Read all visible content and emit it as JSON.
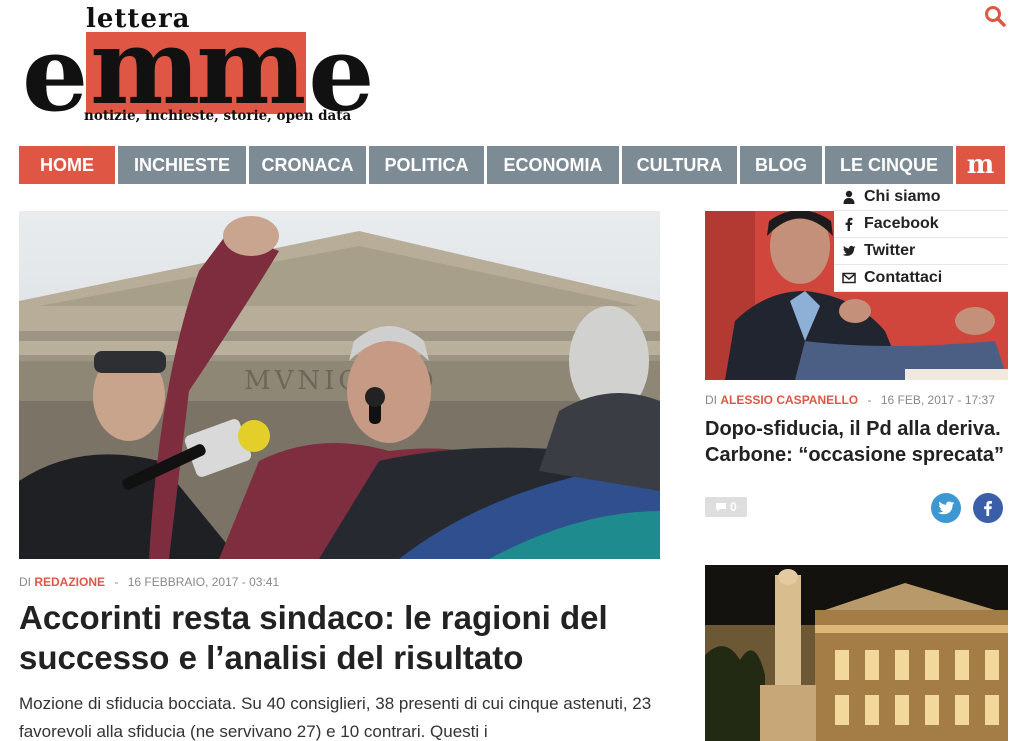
{
  "logo": {
    "top_word": "lettera",
    "main_left": "e",
    "main_mid": "mm",
    "main_right": "e",
    "tagline": "notizie, inchieste, storie, open data"
  },
  "icons": {
    "search": "search-icon",
    "menu_logo": "m-logo-icon"
  },
  "nav": {
    "items": [
      {
        "label": "HOME",
        "active": true
      },
      {
        "label": "INCHIESTE"
      },
      {
        "label": "CRONACA"
      },
      {
        "label": "POLITICA"
      },
      {
        "label": "ECONOMIA"
      },
      {
        "label": "CULTURA"
      },
      {
        "label": "BLOG"
      },
      {
        "label": "LE CINQUE"
      }
    ],
    "m_label": "m"
  },
  "dropdown": {
    "items": [
      {
        "label": "Chi siamo",
        "icon": "user-icon"
      },
      {
        "label": "Facebook",
        "icon": "facebook-icon"
      },
      {
        "label": "Twitter",
        "icon": "twitter-icon"
      },
      {
        "label": "Contattaci",
        "icon": "envelope-icon"
      }
    ]
  },
  "main_article": {
    "by": "DI",
    "author": "REDAZIONE",
    "date": "16 FEBBRAIO, 2017 - 03:41",
    "title": "Accorinti resta sindaco: le ragioni del successo e l’analisi del risultato",
    "excerpt": "Mozione di sfiducia bocciata. Su 40 consiglieri, 38 presenti di cui cinque astenuti, 23 favorevoli alla sfiducia (ne servivano 27) e 10 contrari. Questi i",
    "photo_text": "MVNICIPIO"
  },
  "side_article": {
    "by": "DI",
    "author": "ALESSIO CASPANELLO",
    "date": "16 FEB, 2017 - 17:37",
    "title": "Dopo-sfiducia, il Pd alla deriva. Carbone: “occasione sprecata”",
    "comments": "0"
  },
  "colors": {
    "accent": "#e05645",
    "nav": "#7d8b95",
    "twitter": "#3d97d3",
    "facebook": "#3b5ea8"
  }
}
